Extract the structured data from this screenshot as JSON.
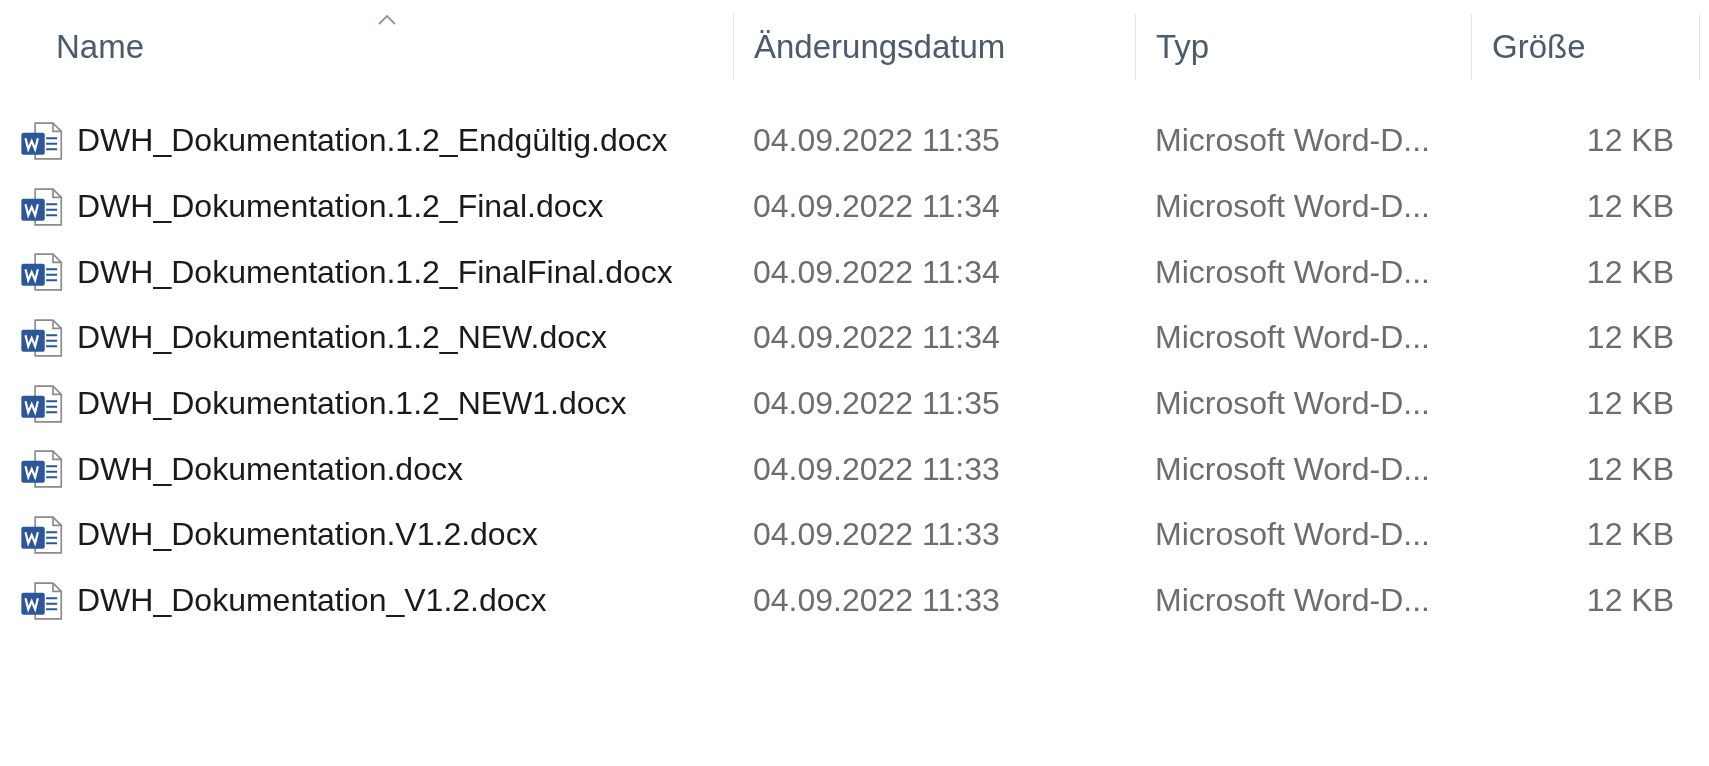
{
  "table": {
    "columns": [
      {
        "label": "Name",
        "sorted_ascending": true
      },
      {
        "label": "Änderungsdatum",
        "sorted_ascending": false
      },
      {
        "label": "Typ",
        "sorted_ascending": false
      },
      {
        "label": "Größe",
        "sorted_ascending": false
      }
    ],
    "rows": [
      {
        "name": "DWH_Dokumentation.1.2_Endgültig.docx",
        "modified": "04.09.2022 11:35",
        "type": "Microsoft Word-D...",
        "size": "12 KB"
      },
      {
        "name": "DWH_Dokumentation.1.2_Final.docx",
        "modified": "04.09.2022 11:34",
        "type": "Microsoft Word-D...",
        "size": "12 KB"
      },
      {
        "name": "DWH_Dokumentation.1.2_FinalFinal.docx",
        "modified": "04.09.2022 11:34",
        "type": "Microsoft Word-D...",
        "size": "12 KB"
      },
      {
        "name": "DWH_Dokumentation.1.2_NEW.docx",
        "modified": "04.09.2022 11:34",
        "type": "Microsoft Word-D...",
        "size": "12 KB"
      },
      {
        "name": "DWH_Dokumentation.1.2_NEW1.docx",
        "modified": "04.09.2022 11:35",
        "type": "Microsoft Word-D...",
        "size": "12 KB"
      },
      {
        "name": "DWH_Dokumentation.docx",
        "modified": "04.09.2022 11:33",
        "type": "Microsoft Word-D...",
        "size": "12 KB"
      },
      {
        "name": "DWH_Dokumentation.V1.2.docx",
        "modified": "04.09.2022 11:33",
        "type": "Microsoft Word-D...",
        "size": "12 KB"
      },
      {
        "name": "DWH_Dokumentation_V1.2.docx",
        "modified": "04.09.2022 11:33",
        "type": "Microsoft Word-D...",
        "size": "12 KB"
      }
    ]
  }
}
